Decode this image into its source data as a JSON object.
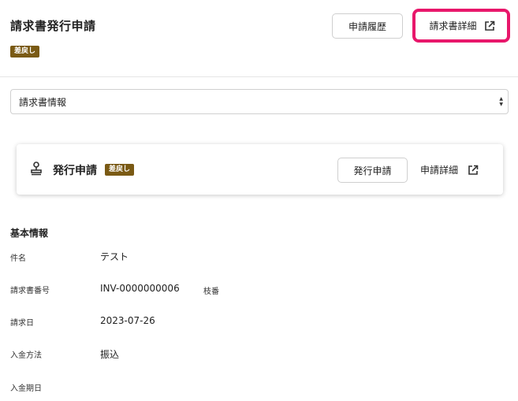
{
  "header": {
    "title": "請求書発行申請",
    "status_badge": "差戻し",
    "history_button": "申請履歴",
    "invoice_detail_button": "請求書詳細"
  },
  "select": {
    "value": "請求書情報"
  },
  "card": {
    "title": "発行申請",
    "status_badge": "差戻し",
    "issue_button": "発行申請",
    "detail_link": "申請詳細"
  },
  "basic_info": {
    "title": "基本情報",
    "rows": [
      {
        "label": "件名",
        "value": "テスト"
      },
      {
        "label": "請求書番号",
        "value": "INV-0000000006",
        "sub_label": "枝番"
      },
      {
        "label": "請求日",
        "value": "2023-07-26"
      },
      {
        "label": "入金方法",
        "value": "振込"
      },
      {
        "label": "入金期日",
        "value": ""
      }
    ]
  },
  "colors": {
    "badge": "#7a5a14",
    "highlight_border": "#e8176b"
  },
  "icons": {
    "external_link": "external-link-icon",
    "stamp": "stamp-icon",
    "select_arrows": "select-arrows-icon"
  }
}
